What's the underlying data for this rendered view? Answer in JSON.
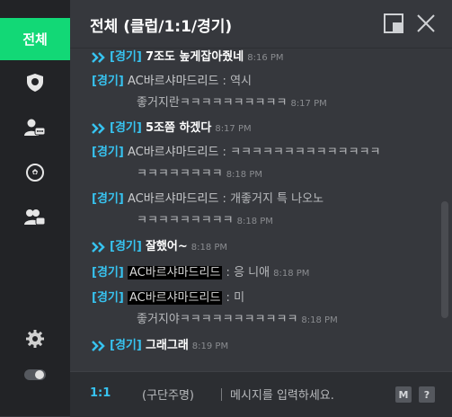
{
  "sidebar": {
    "tab_all": "전체"
  },
  "header": {
    "title": "전체 (클럽/1:1/경기)"
  },
  "tag": "[경기]",
  "messages": [
    {
      "kind": "system",
      "text": "7조도 높게잡아줬네",
      "time": "8:16 PM"
    },
    {
      "kind": "user",
      "sender": "AC바르샤마드리드",
      "sep": " : ",
      "text": "역시",
      "cont": "좋거지란ㅋㅋㅋㅋㅋㅋㅋㅋㅋㅋ",
      "time": "8:17 PM"
    },
    {
      "kind": "system",
      "text": "5조쯤 하겠다",
      "time": "8:17 PM"
    },
    {
      "kind": "user",
      "sender": "AC바르샤마드리드",
      "sep": " : ",
      "text": "ㅋㅋㅋㅋㅋㅋㅋㅋㅋㅋㅋㅋㅋㅋ",
      "cont": "ㅋㅋㅋㅋㅋㅋㅋㅋ",
      "time": "8:18 PM"
    },
    {
      "kind": "user",
      "sender": "AC바르샤마드리드",
      "sep": " : ",
      "text": "개좋거지 특 나오노",
      "cont": "ㅋㅋㅋㅋㅋㅋㅋㅋㅋ",
      "time": "8:18 PM"
    },
    {
      "kind": "system",
      "text": "잘했어~",
      "time": "8:18 PM"
    },
    {
      "kind": "user",
      "sender": "AC바르샤마드리드",
      "sep": " : ",
      "text": "응 니애",
      "time": "8:18 PM"
    },
    {
      "kind": "user",
      "sender": "AC바르샤마드리드",
      "sep": " : ",
      "text": "미",
      "cont": "좋거지야ㅋㅋㅋㅋㅋㅋㅋㅋㅋㅋㅋ",
      "time": "8:18 PM"
    },
    {
      "kind": "system",
      "text": "그래그래",
      "time": "8:19 PM"
    }
  ],
  "bottom": {
    "mode": "1:1",
    "whisper": "(구단주명)",
    "input_placeholder": "메시지를 입력하세요.",
    "macro_key": "M",
    "help_key": "?"
  },
  "colors": {
    "accent": "#12d876",
    "tag": "#37c3f0",
    "background": "#36383d",
    "sidebar": "#222326"
  }
}
